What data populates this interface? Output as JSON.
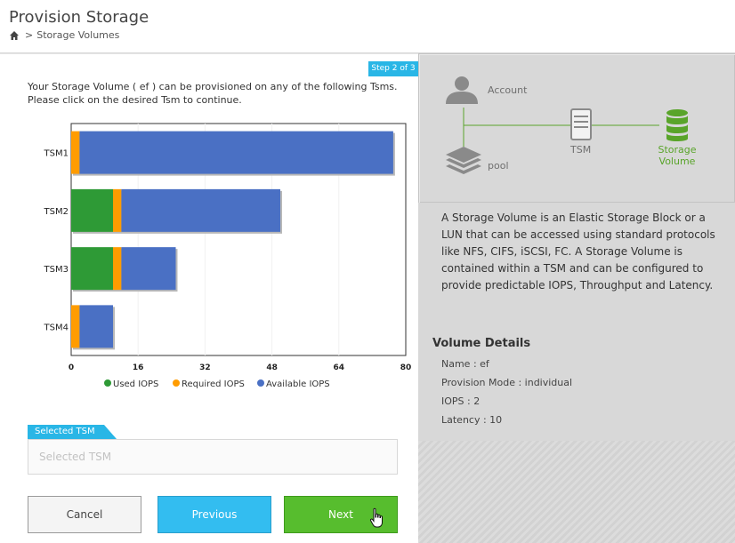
{
  "header": {
    "title": "Provision Storage",
    "breadcrumb": "Storage Volumes"
  },
  "wizard": {
    "step": "Step 2 of 3",
    "intro": "Your Storage Volume ( ef ) can be provisioned on any of the following Tsms. Please click on the desired Tsm to continue."
  },
  "chart_data": {
    "type": "bar",
    "orientation": "horizontal",
    "stacked": true,
    "categories": [
      "TSM1",
      "TSM2",
      "TSM3",
      "TSM4"
    ],
    "series": [
      {
        "name": "Used IOPS",
        "color": "#2e9a36",
        "values": [
          0,
          10,
          10,
          0
        ]
      },
      {
        "name": "Required IOPS",
        "color": "#ff9c00",
        "values": [
          2,
          2,
          2,
          2
        ]
      },
      {
        "name": "Available IOPS",
        "color": "#4a70c4",
        "values": [
          75,
          38,
          13,
          8
        ]
      }
    ],
    "xlim": [
      0,
      80
    ],
    "xticks": [
      "0",
      "16",
      "32",
      "48",
      "64",
      "80"
    ],
    "legend_position": "bottom",
    "grid": true
  },
  "selected_tsm": {
    "tab_label": "Selected TSM",
    "placeholder": "Selected TSM"
  },
  "buttons": {
    "cancel": "Cancel",
    "previous": "Previous",
    "next": "Next"
  },
  "diagram": {
    "account": "Account",
    "pool": "pool",
    "tsm": "TSM",
    "storage_line1": "Storage",
    "storage_line2": "Volume",
    "active_color": "#59a42a"
  },
  "description": "A Storage Volume is an Elastic Storage Block or a LUN that can be accessed using standard protocols like NFS, CIFS, iSCSI, FC. A Storage Volume is contained within a TSM and can be configured to provide predictable IOPS, Throughput and Latency.",
  "volume_details": {
    "title": "Volume Details",
    "name": "Name : ef",
    "provision_mode": "Provision Mode : individual",
    "iops": "IOPS : 2",
    "latency": "Latency : 10"
  }
}
